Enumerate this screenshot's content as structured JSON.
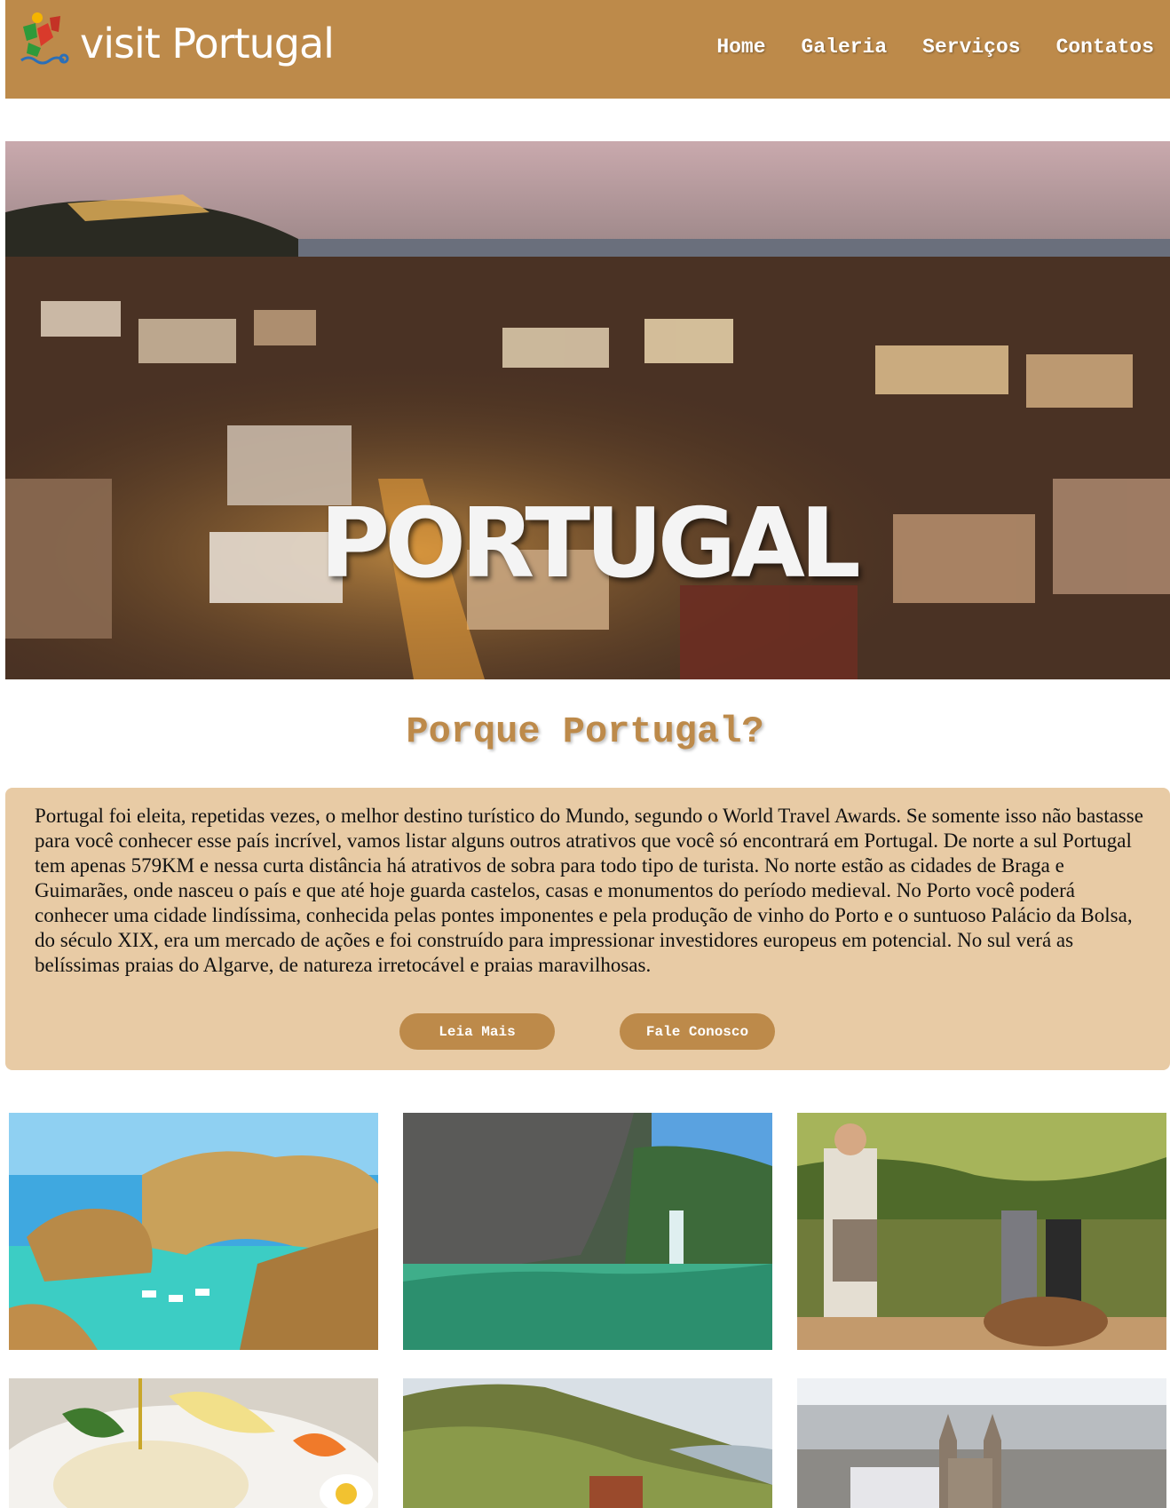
{
  "header": {
    "logo_text": "visit Portugal",
    "nav": [
      {
        "label": "Home"
      },
      {
        "label": "Galeria"
      },
      {
        "label": "Serviços"
      },
      {
        "label": "Contatos"
      }
    ],
    "background": "#bd8a4a"
  },
  "hero": {
    "title": "PORTUGAL"
  },
  "main": {
    "section_title": "Porque Portugal?",
    "paragraph": "Portugal foi eleita, repetidas vezes, o melhor destino turístico do Mundo, segundo o World Travel Awards. Se somente isso não bastasse para você conhecer esse país incrível, vamos listar alguns outros atrativos que você só encontrará em Portugal. De norte a sul Portugal tem apenas 579KM e nessa curta distância há atrativos de sobra para todo tipo de turista. No norte estão as cidades de Braga e Guimarães, onde nasceu o país e que até hoje guarda castelos, casas e monumentos do período medieval. No Porto você poderá conhecer uma cidade lindíssima, conhecida pelas pontes imponentes e pela produção de vinho do Porto e o suntuoso Palácio da Bolsa, do século XIX, era um mercado de ações e foi construído para impressionar investidores europeus em potencial. No sul verá as belíssimas praias do Algarve, de natureza irretocável e praias maravilhosas.",
    "buttons": {
      "read_more": "Leia Mais",
      "contact": "Fale Conosco"
    }
  },
  "colors": {
    "accent": "#bd8a4a",
    "box_background": "#e8cba5"
  }
}
